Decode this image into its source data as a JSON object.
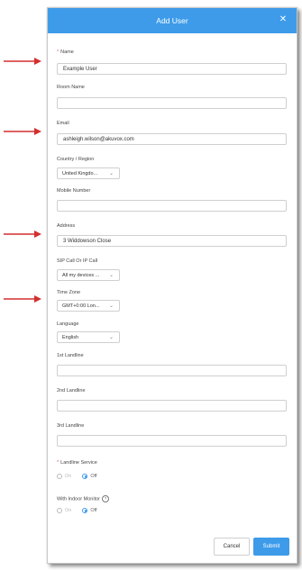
{
  "dialog": {
    "title": "Add User",
    "close_icon": "close-icon"
  },
  "fields": {
    "name": {
      "label": "Name",
      "required_marker": "*",
      "value": "Example User"
    },
    "room_name": {
      "label": "Room Name",
      "value": ""
    },
    "email": {
      "label": "Email",
      "value": "ashleigh.wilson@akuvox.com"
    },
    "country": {
      "label": "Country / Region",
      "value": "United Kingdo..."
    },
    "mobile": {
      "label": "Mobile Number",
      "value": ""
    },
    "address": {
      "label": "Address",
      "value": "3 Widdowson Close"
    },
    "sip": {
      "label": "SIP Call Or IP Call",
      "value": "All my devices ..."
    },
    "timezone": {
      "label": "Time Zone",
      "value": "GMT+0:00 Lon..."
    },
    "language": {
      "label": "Language",
      "value": "English"
    },
    "landline1": {
      "label": "1st Landline",
      "value": ""
    },
    "landline2": {
      "label": "2nd Landline",
      "value": ""
    },
    "landline3": {
      "label": "3rd Landline",
      "value": ""
    },
    "landline_service": {
      "label": "Landline Service",
      "required_marker": "*",
      "on": "On",
      "off": "Off",
      "selected": "Off"
    },
    "indoor_monitor": {
      "label": "With Indoor Monitor",
      "help": "?",
      "on": "On",
      "off": "Off",
      "selected": "Off"
    }
  },
  "buttons": {
    "cancel": "Cancel",
    "submit": "Submit"
  },
  "colors": {
    "accent": "#3d9bea",
    "arrow": "#d32f2f"
  }
}
